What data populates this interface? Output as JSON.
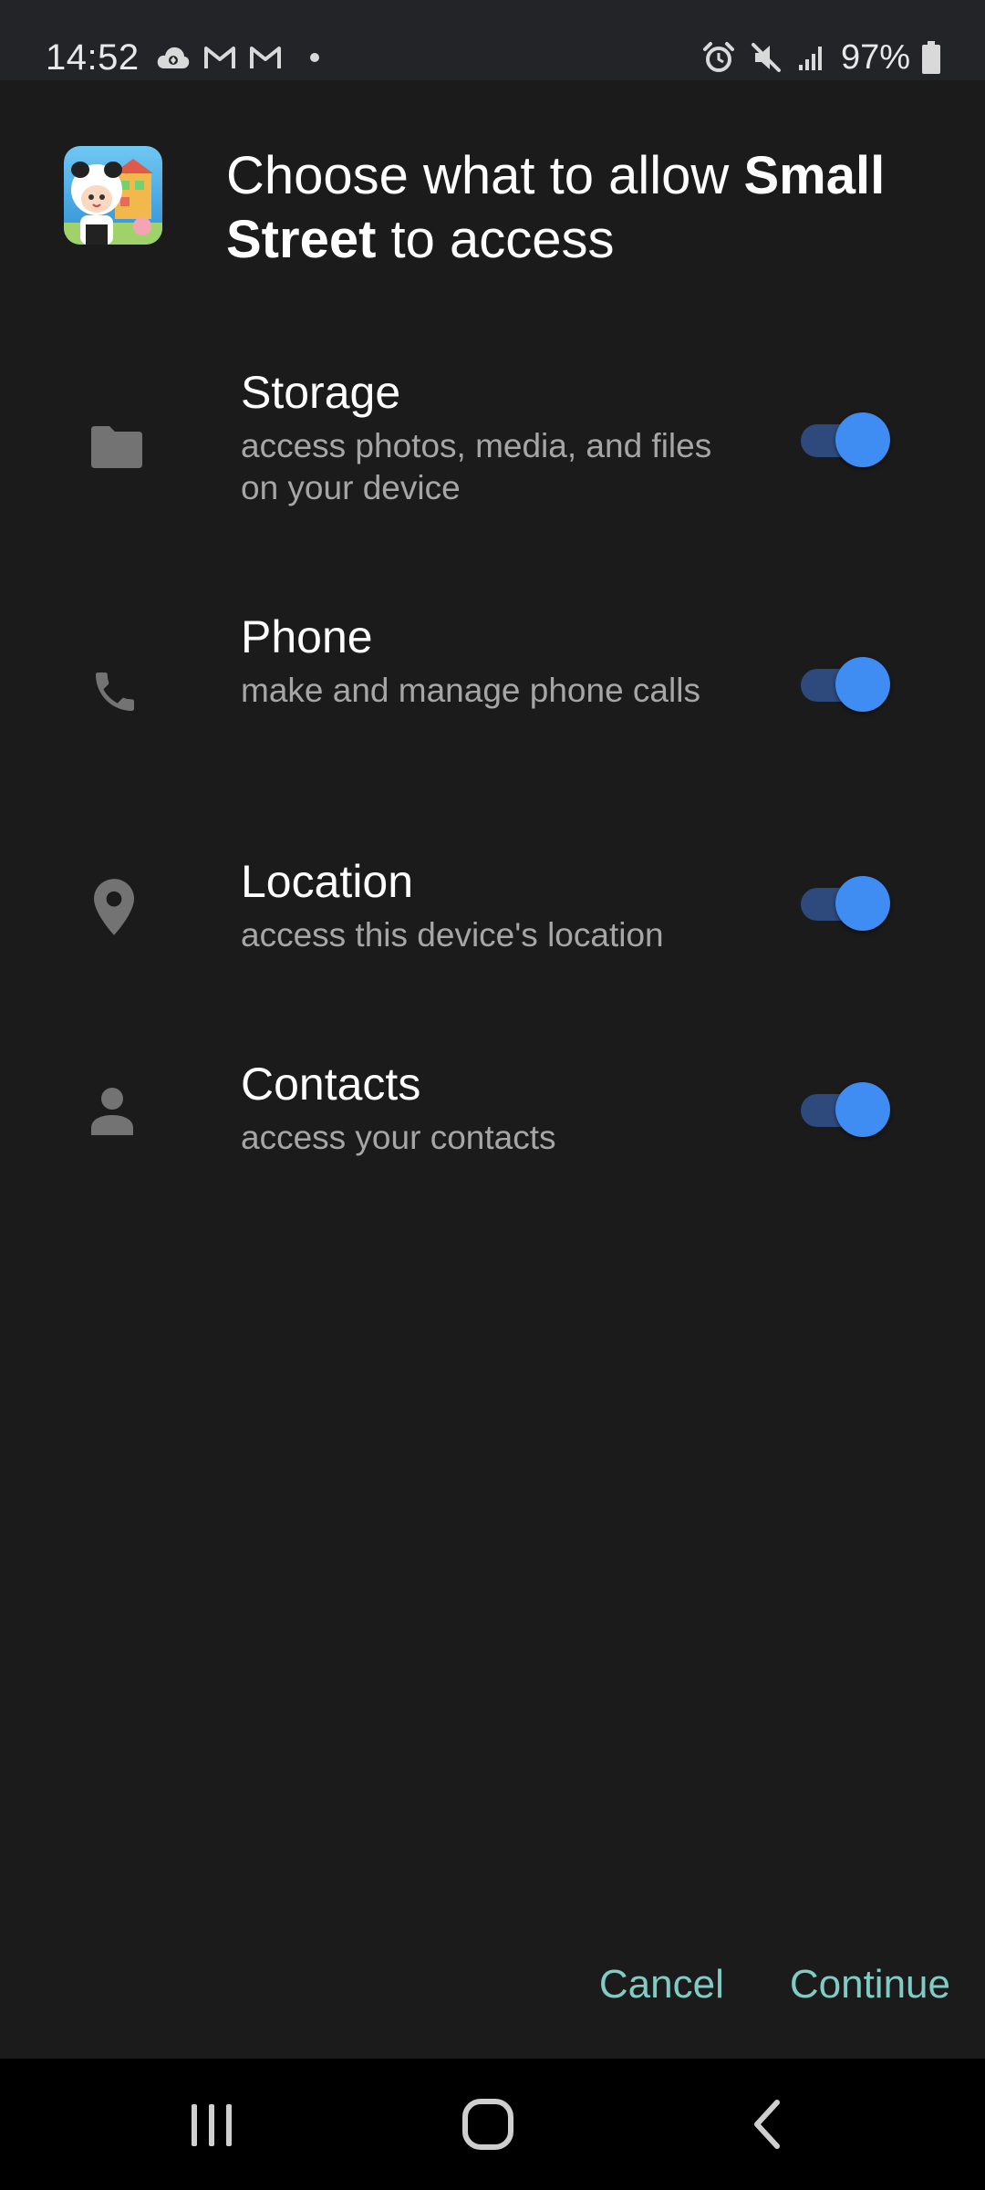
{
  "status_bar": {
    "time": "14:52",
    "battery_percent": "97%",
    "left_icons": [
      "cloud-sync-icon",
      "gmail-icon",
      "gmail-icon",
      "notification-dot-icon"
    ],
    "right_icons": [
      "alarm-icon",
      "mute-icon",
      "signal-icon",
      "battery-icon"
    ]
  },
  "dialog": {
    "title_prefix": "Choose what to allow ",
    "app_name": "Small Street",
    "title_suffix": " to access",
    "app_icon": "small-street-app-icon"
  },
  "permissions": [
    {
      "title": "Storage",
      "description": "access photos, media, and files on your device",
      "icon": "folder-icon",
      "enabled": true
    },
    {
      "title": "Phone",
      "description": "make and manage phone calls",
      "icon": "phone-icon",
      "enabled": true
    },
    {
      "title": "Location",
      "description": "access this device's location",
      "icon": "location-pin-icon",
      "enabled": true
    },
    {
      "title": "Contacts",
      "description": "access your contacts",
      "icon": "person-icon",
      "enabled": true
    }
  ],
  "actions": {
    "cancel_label": "Cancel",
    "continue_label": "Continue"
  },
  "nav_bar": {
    "buttons": [
      "recent-apps-icon",
      "home-icon",
      "back-icon"
    ]
  },
  "colors": {
    "background": "#1b1b1b",
    "status_bar": "#222427",
    "accent_toggle": "#3f8cf3",
    "toggle_track": "#2e4a7c",
    "action_text": "#80cbc4",
    "secondary_text": "#a6a6a6"
  }
}
